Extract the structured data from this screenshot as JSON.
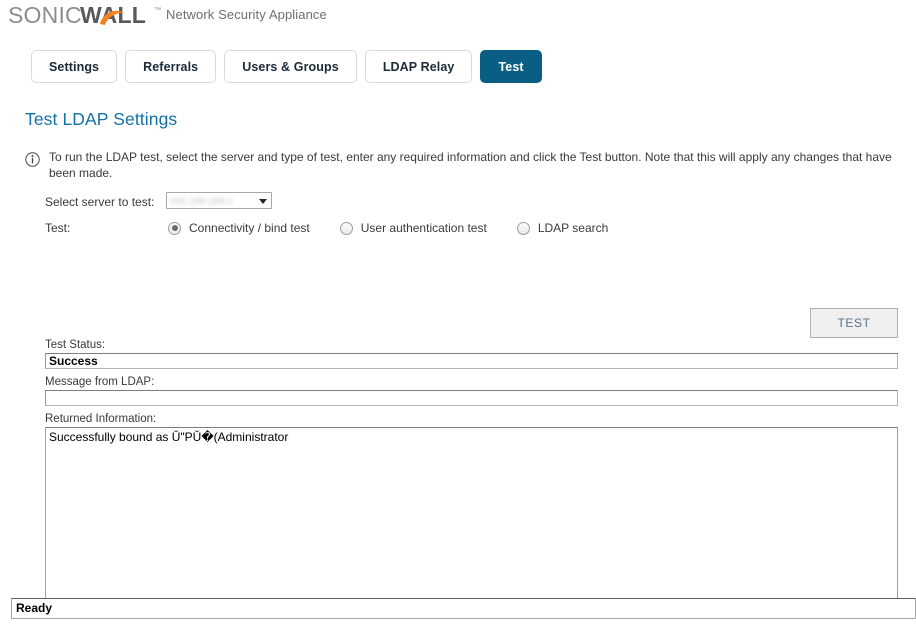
{
  "header": {
    "brand_sonic": "SONIC",
    "brand_wall": "WALL",
    "brand_tm": "™",
    "product": "Network Security Appliance"
  },
  "tabs": [
    {
      "label": "Settings",
      "active": false
    },
    {
      "label": "Referrals",
      "active": false
    },
    {
      "label": "Users & Groups",
      "active": false
    },
    {
      "label": "LDAP Relay",
      "active": false
    },
    {
      "label": "Test",
      "active": true
    }
  ],
  "page": {
    "title": "Test LDAP Settings",
    "info_icon": "info-circle-icon",
    "info_text": "To run the LDAP test, select the server and type of test, enter any required information and click the Test button. Note that this will apply any changes that have been made."
  },
  "form": {
    "server_label": "Select server to test:",
    "server_value": "192.168.168.2",
    "server_dropdown_icon": "chevron-down-icon",
    "test_label": "Test:",
    "test_options": [
      {
        "label": "Connectivity / bind test",
        "selected": true
      },
      {
        "label": "User authentication test",
        "selected": false
      },
      {
        "label": "LDAP search",
        "selected": false
      }
    ]
  },
  "actions": {
    "test_button": "TEST"
  },
  "results": {
    "status_label": "Test Status:",
    "status_value": "Success",
    "message_label": "Message from LDAP:",
    "message_value": "",
    "returned_label": "Returned Information:",
    "returned_value": "Successfully bound as Ŭ\"PŬ�(Administrator"
  },
  "statusbar": {
    "text": "Ready"
  },
  "colors": {
    "accent_blue": "#1271a8",
    "tab_active": "#0b5e83",
    "brand_orange": "#f58220",
    "brand_gray": "#58595b"
  }
}
